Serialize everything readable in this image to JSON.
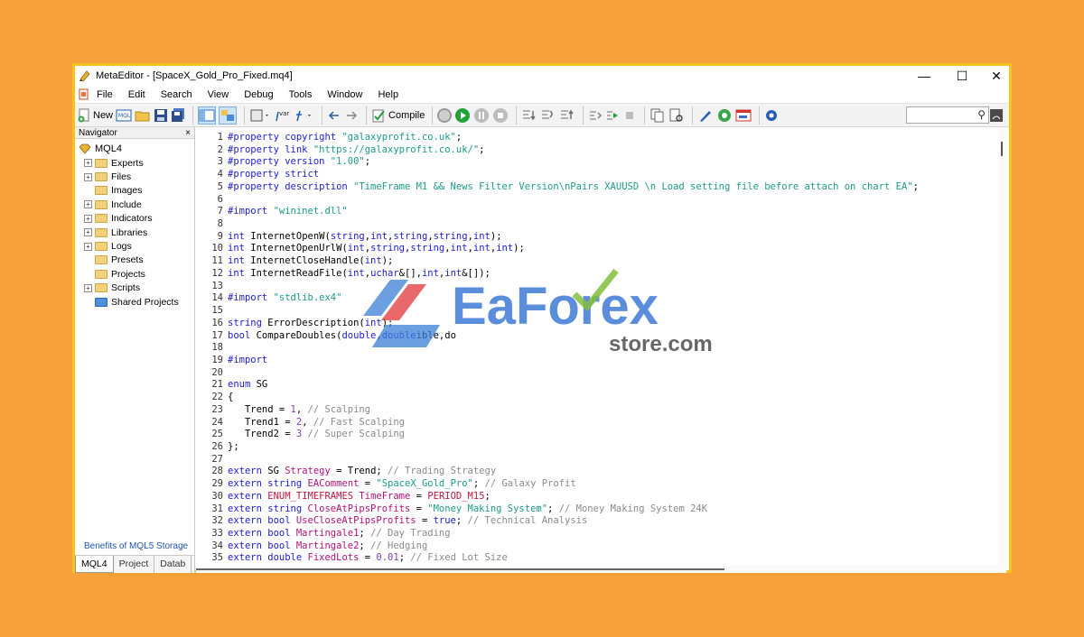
{
  "window": {
    "title": "MetaEditor - [SpaceX_Gold_Pro_Fixed.mq4]"
  },
  "menu": [
    "File",
    "Edit",
    "Search",
    "View",
    "Debug",
    "Tools",
    "Window",
    "Help"
  ],
  "toolbar": {
    "new_label": "New",
    "compile_label": "Compile"
  },
  "navigator": {
    "title": "Navigator",
    "close": "×",
    "root": "MQL4",
    "items": [
      {
        "label": "Experts",
        "expandable": true
      },
      {
        "label": "Files",
        "expandable": true
      },
      {
        "label": "Images",
        "expandable": false
      },
      {
        "label": "Include",
        "expandable": true
      },
      {
        "label": "Indicators",
        "expandable": true
      },
      {
        "label": "Libraries",
        "expandable": true
      },
      {
        "label": "Logs",
        "expandable": true
      },
      {
        "label": "Presets",
        "expandable": false
      },
      {
        "label": "Projects",
        "expandable": false
      },
      {
        "label": "Scripts",
        "expandable": true
      },
      {
        "label": "Shared Projects",
        "expandable": false,
        "special": true
      }
    ],
    "link": "Benefits of MQL5 Storage",
    "tabs": [
      "MQL4",
      "Project",
      "Datab"
    ]
  },
  "watermark": {
    "brand": "EaForex",
    "sub": "store.com"
  },
  "code_lines": [
    [
      [
        "1",
        "ln"
      ],
      [
        "#property copyright ",
        "kw"
      ],
      [
        "\"galaxyprofit.co.uk\"",
        "str"
      ],
      [
        ";",
        "p"
      ]
    ],
    [
      [
        "2",
        "ln"
      ],
      [
        "#property link ",
        "kw"
      ],
      [
        "\"https://galaxyprofit.co.uk/\"",
        "str"
      ],
      [
        ";",
        "p"
      ]
    ],
    [
      [
        "3",
        "ln"
      ],
      [
        "#property version ",
        "kw"
      ],
      [
        "\"1.00\"",
        "str"
      ],
      [
        ";",
        "p"
      ]
    ],
    [
      [
        "4",
        "ln"
      ],
      [
        "#property strict",
        "kw"
      ]
    ],
    [
      [
        "5",
        "ln"
      ],
      [
        "#property description ",
        "kw"
      ],
      [
        "\"TimeFrame M1 && News Filter Version\\nPairs XAUUSD \\n Load setting file before attach on chart EA\"",
        "str"
      ],
      [
        ";",
        "p"
      ]
    ],
    [
      [
        "6",
        "ln"
      ]
    ],
    [
      [
        "7",
        "ln"
      ],
      [
        "#import ",
        "kw"
      ],
      [
        "\"wininet.dll\"",
        "str"
      ]
    ],
    [
      [
        "8",
        "ln"
      ]
    ],
    [
      [
        "9",
        "ln"
      ],
      [
        "int ",
        "kw"
      ],
      [
        "InternetOpenW(",
        "p"
      ],
      [
        "string",
        "kw"
      ],
      [
        ",",
        "p"
      ],
      [
        "int",
        "kw"
      ],
      [
        ",",
        "p"
      ],
      [
        "string",
        "kw"
      ],
      [
        ",",
        "p"
      ],
      [
        "string",
        "kw"
      ],
      [
        ",",
        "p"
      ],
      [
        "int",
        "kw"
      ],
      [
        ");",
        "p"
      ]
    ],
    [
      [
        "10",
        "ln"
      ],
      [
        "int ",
        "kw"
      ],
      [
        "InternetOpenUrlW(",
        "p"
      ],
      [
        "int",
        "kw"
      ],
      [
        ",",
        "p"
      ],
      [
        "string",
        "kw"
      ],
      [
        ",",
        "p"
      ],
      [
        "string",
        "kw"
      ],
      [
        ",",
        "p"
      ],
      [
        "int",
        "kw"
      ],
      [
        ",",
        "p"
      ],
      [
        "int",
        "kw"
      ],
      [
        ",",
        "p"
      ],
      [
        "int",
        "kw"
      ],
      [
        ");",
        "p"
      ]
    ],
    [
      [
        "11",
        "ln"
      ],
      [
        "int ",
        "kw"
      ],
      [
        "InternetCloseHandle(",
        "p"
      ],
      [
        "int",
        "kw"
      ],
      [
        ");",
        "p"
      ]
    ],
    [
      [
        "12",
        "ln"
      ],
      [
        "int ",
        "kw"
      ],
      [
        "InternetReadFile(",
        "p"
      ],
      [
        "int",
        "kw"
      ],
      [
        ",",
        "p"
      ],
      [
        "uchar",
        "kw"
      ],
      [
        "&[],",
        "p"
      ],
      [
        "int",
        "kw"
      ],
      [
        ",",
        "p"
      ],
      [
        "int",
        "kw"
      ],
      [
        "&[]);",
        "p"
      ]
    ],
    [
      [
        "13",
        "ln"
      ]
    ],
    [
      [
        "14",
        "ln"
      ],
      [
        "#import ",
        "kw"
      ],
      [
        "\"stdlib.ex4\"",
        "str"
      ]
    ],
    [
      [
        "15",
        "ln"
      ]
    ],
    [
      [
        "16",
        "ln"
      ],
      [
        "string ",
        "kw"
      ],
      [
        "ErrorDescription(",
        "p"
      ],
      [
        "int",
        "kw"
      ],
      [
        ");",
        "p"
      ]
    ],
    [
      [
        "17",
        "ln"
      ],
      [
        "bool ",
        "kw"
      ],
      [
        "CompareDoubles(",
        "p"
      ],
      [
        "double",
        "kw"
      ],
      [
        ",",
        "p"
      ],
      [
        "double",
        "kw"
      ],
      [
        "ible,do",
        "p"
      ]
    ],
    [
      [
        "18",
        "ln"
      ]
    ],
    [
      [
        "19",
        "ln"
      ],
      [
        "#import",
        "kw"
      ]
    ],
    [
      [
        "20",
        "ln"
      ]
    ],
    [
      [
        "21",
        "ln"
      ],
      [
        "enum ",
        "kw"
      ],
      [
        "SG",
        "p"
      ]
    ],
    [
      [
        "22",
        "ln"
      ],
      [
        "{",
        "p"
      ]
    ],
    [
      [
        "23",
        "ln"
      ],
      [
        "   Trend = ",
        "p"
      ],
      [
        "1",
        "num"
      ],
      [
        ", ",
        "p"
      ],
      [
        "// Scalping",
        "cm"
      ]
    ],
    [
      [
        "24",
        "ln"
      ],
      [
        "   Trend1 = ",
        "p"
      ],
      [
        "2",
        "num"
      ],
      [
        ", ",
        "p"
      ],
      [
        "// Fast Scalping",
        "cm"
      ]
    ],
    [
      [
        "25",
        "ln"
      ],
      [
        "   Trend2 = ",
        "p"
      ],
      [
        "3",
        "num"
      ],
      [
        " ",
        "p"
      ],
      [
        "// Super Scalping",
        "cm"
      ]
    ],
    [
      [
        "26",
        "ln"
      ],
      [
        "};",
        "p"
      ]
    ],
    [
      [
        "27",
        "ln"
      ]
    ],
    [
      [
        "28",
        "ln"
      ],
      [
        "extern ",
        "kw"
      ],
      [
        "SG ",
        "p"
      ],
      [
        "Strategy",
        "var"
      ],
      [
        " = Trend; ",
        "p"
      ],
      [
        "// Trading Strategy",
        "cm"
      ]
    ],
    [
      [
        "29",
        "ln"
      ],
      [
        "extern string ",
        "kw"
      ],
      [
        "EAComment",
        "var"
      ],
      [
        " = ",
        "p"
      ],
      [
        "\"SpaceX_Gold_Pro\"",
        "str"
      ],
      [
        "; ",
        "p"
      ],
      [
        "// Galaxy Profit",
        "cm"
      ]
    ],
    [
      [
        "30",
        "ln"
      ],
      [
        "extern ",
        "kw"
      ],
      [
        "ENUM_TIMEFRAMES ",
        "en"
      ],
      [
        "TimeFrame",
        "var"
      ],
      [
        " = ",
        "p"
      ],
      [
        "PERIOD_M15",
        "en"
      ],
      [
        ";",
        "p"
      ]
    ],
    [
      [
        "31",
        "ln"
      ],
      [
        "extern string ",
        "kw"
      ],
      [
        "CloseAtPipsProfits",
        "var"
      ],
      [
        " = ",
        "p"
      ],
      [
        "\"Money Making System\"",
        "str"
      ],
      [
        "; ",
        "p"
      ],
      [
        "// Money Making System 24K",
        "cm"
      ]
    ],
    [
      [
        "32",
        "ln"
      ],
      [
        "extern bool ",
        "kw"
      ],
      [
        "UseCloseAtPipsProfits",
        "var"
      ],
      [
        " = ",
        "p"
      ],
      [
        "true",
        "kw"
      ],
      [
        "; ",
        "p"
      ],
      [
        "// Technical Analysis",
        "cm"
      ]
    ],
    [
      [
        "33",
        "ln"
      ],
      [
        "extern bool ",
        "kw"
      ],
      [
        "Martingale1",
        "var"
      ],
      [
        "; ",
        "p"
      ],
      [
        "// Day Trading",
        "cm"
      ]
    ],
    [
      [
        "34",
        "ln"
      ],
      [
        "extern bool ",
        "kw"
      ],
      [
        "Martingale2",
        "var"
      ],
      [
        "; ",
        "p"
      ],
      [
        "// Hedging",
        "cm"
      ]
    ],
    [
      [
        "35",
        "ln"
      ],
      [
        "extern double ",
        "kw"
      ],
      [
        "FixedLots",
        "var"
      ],
      [
        " = ",
        "p"
      ],
      [
        "0.01",
        "num"
      ],
      [
        "; ",
        "p"
      ],
      [
        "// Fixed Lot Size",
        "cm"
      ]
    ]
  ],
  "colors": {
    "kw": "#1c1ccf",
    "str": "#1c9a8a",
    "num": "#7a3fb0",
    "cm": "#8a8a8a",
    "var": "#b1127b",
    "en": "#c0163c",
    "p": "#000000",
    "ln": "#333333",
    "background": "#f7a13a",
    "frame": "#f6c21e"
  }
}
